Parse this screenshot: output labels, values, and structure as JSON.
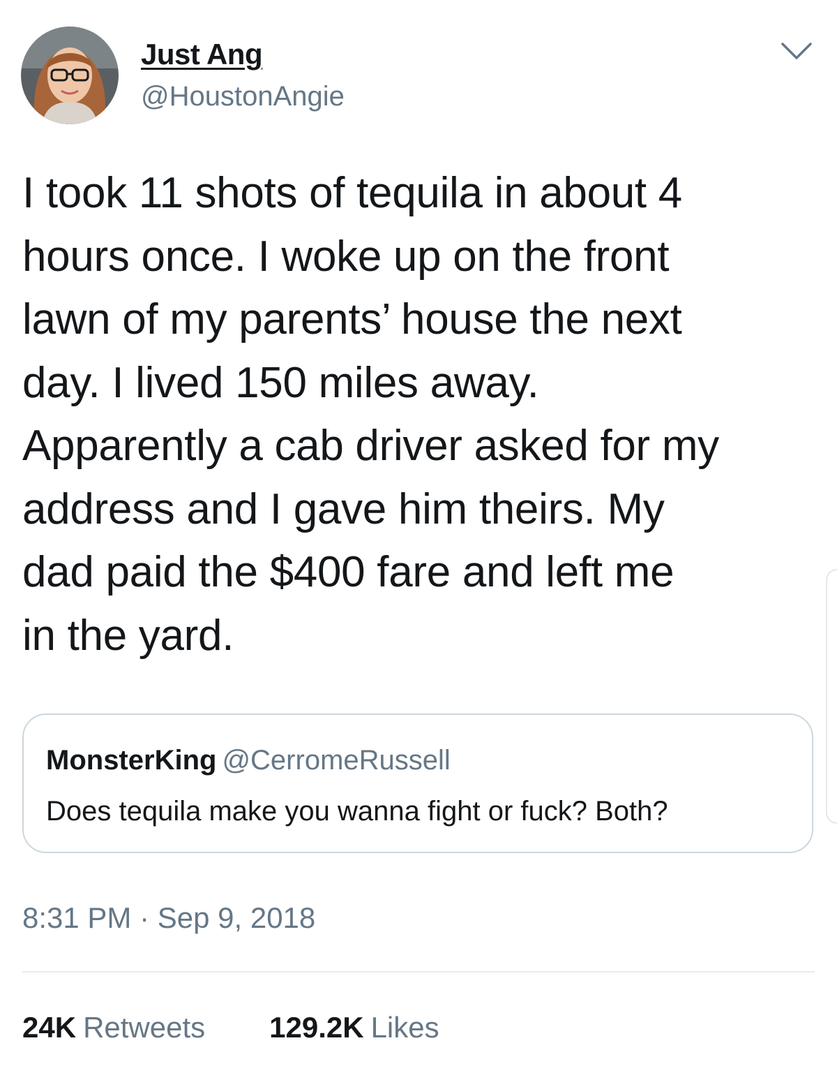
{
  "author": {
    "display_name": "Just Ang",
    "handle": "@HoustonAngie",
    "avatar": "profile-photo"
  },
  "tweet": {
    "text": "I took 11 shots of tequila in about 4\nhours once. I woke up on the front\nlawn of my parents’ house the next\nday. I lived 150 miles away.\nApparently a cab driver asked for my\naddress and I gave him theirs. My\ndad paid the $400 fare and left me\nin the yard."
  },
  "quoted_tweet": {
    "display_name": "MonsterKing",
    "handle": "@CerromeRussell",
    "text": "Does tequila make you wanna fight or fuck? Both?"
  },
  "meta": {
    "timestamp": "8:31 PM · Sep 9, 2018"
  },
  "stats": {
    "retweets_count": "24K",
    "retweets_label": "Retweets",
    "likes_count": "129.2K",
    "likes_label": "Likes"
  },
  "icons": {
    "menu": "chevron-down-icon"
  },
  "colors": {
    "text_primary": "#14171a",
    "text_secondary": "#657786",
    "border": "#ccd6dd",
    "divider": "#e6ecf0"
  }
}
